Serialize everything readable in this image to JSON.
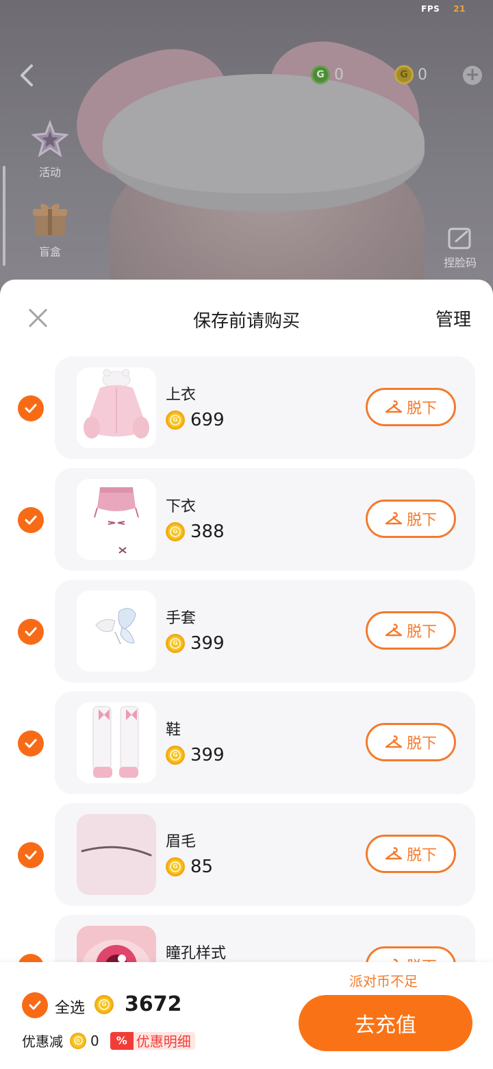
{
  "status": {
    "fps_label": "FPS",
    "fps_value": "21"
  },
  "top_bar": {
    "green_currency": "0",
    "gold_currency": "0"
  },
  "side_menu": [
    {
      "label": "活动",
      "icon": "star-event-icon"
    },
    {
      "label": "盲盒",
      "icon": "gift-box-icon"
    }
  ],
  "right_menu": {
    "label": "捏脸码",
    "icon": "face-code-icon"
  },
  "sheet": {
    "title": "保存前请购买",
    "manage": "管理",
    "takeoff_label": "脱下",
    "items": [
      {
        "name": "上衣",
        "price": "699",
        "checked": true,
        "thumb": "top-garment"
      },
      {
        "name": "下衣",
        "price": "388",
        "checked": true,
        "thumb": "bottom-garment"
      },
      {
        "name": "手套",
        "price": "399",
        "checked": true,
        "thumb": "gloves"
      },
      {
        "name": "鞋",
        "price": "399",
        "checked": true,
        "thumb": "shoes"
      },
      {
        "name": "眉毛",
        "price": "85",
        "checked": true,
        "thumb": "eyebrows"
      },
      {
        "name": "瞳孔样式",
        "price": "",
        "checked": true,
        "thumb": "pupil-style"
      }
    ]
  },
  "footer": {
    "select_all": "全选",
    "total": "3672",
    "discount_label": "优惠减",
    "discount_value": "0",
    "detail_badge": "%",
    "detail_label": "优惠明细",
    "insufficient": "派对币不足",
    "recharge": "去充值"
  },
  "colors": {
    "accent": "#f86b16",
    "coin": "#f7c21c",
    "detail_red": "#f23c37"
  }
}
